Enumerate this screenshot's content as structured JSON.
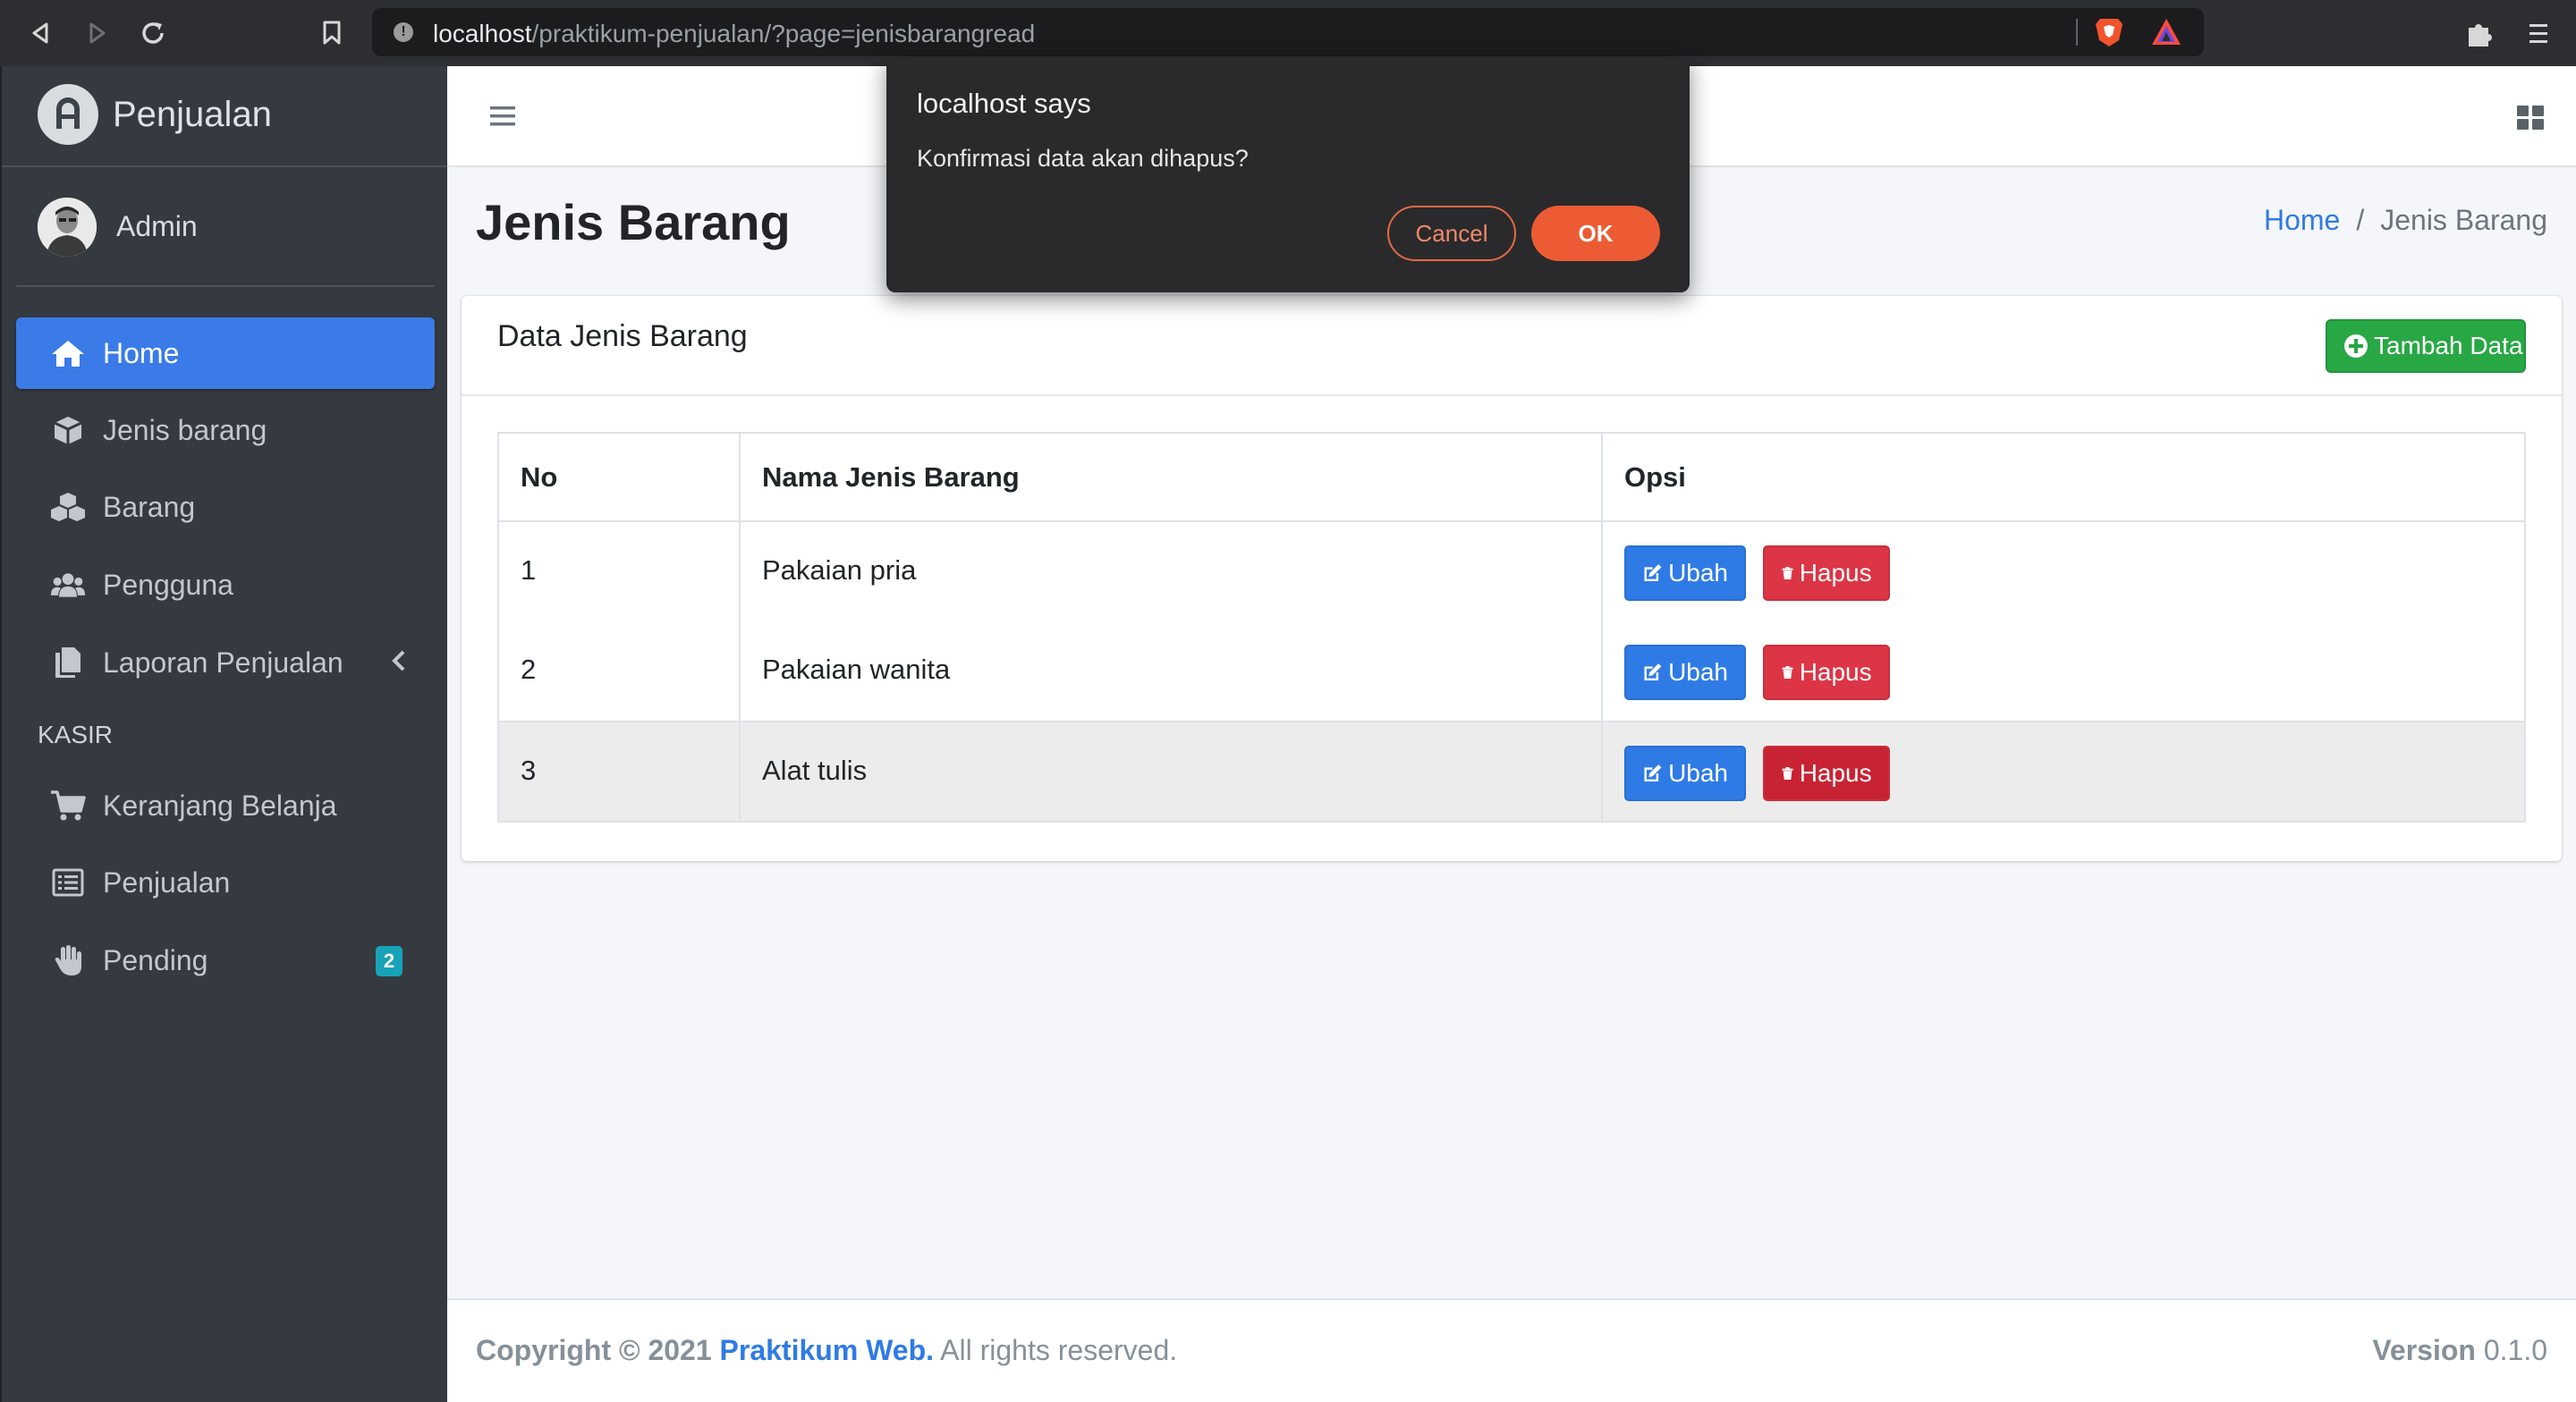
{
  "browser": {
    "url_host": "localhost",
    "url_path": "/praktikum-penjualan/?page=jenisbarangread"
  },
  "sidebar": {
    "brand": "Penjualan",
    "user": "Admin",
    "items": [
      {
        "label": "Home",
        "icon": "home-icon",
        "active": true
      },
      {
        "label": "Jenis barang",
        "icon": "box-icon"
      },
      {
        "label": "Barang",
        "icon": "boxes-icon"
      },
      {
        "label": "Pengguna",
        "icon": "users-icon"
      },
      {
        "label": "Laporan Penjualan",
        "icon": "copy-icon"
      }
    ],
    "section_header": "KASIR",
    "kasir_items": [
      {
        "label": "Keranjang Belanja",
        "icon": "cart-icon"
      },
      {
        "label": "Penjualan",
        "icon": "list-icon"
      },
      {
        "label": "Pending",
        "icon": "hand-icon",
        "badge": "2"
      }
    ]
  },
  "content": {
    "title": "Jenis Barang",
    "breadcrumb": {
      "home": "Home",
      "current": "Jenis Barang"
    },
    "card_title": "Data Jenis Barang",
    "add_button": "Tambah Data",
    "table": {
      "headers": [
        "No",
        "Nama Jenis Barang",
        "Opsi"
      ],
      "rows": [
        {
          "no": "1",
          "name": "Pakaian pria"
        },
        {
          "no": "2",
          "name": "Pakaian wanita"
        },
        {
          "no": "3",
          "name": "Alat tulis"
        }
      ],
      "edit_label": "Ubah",
      "delete_label": "Hapus"
    }
  },
  "footer": {
    "copyright_prefix": "Copyright © 2021",
    "copyright_link": "Praktikum Web.",
    "copyright_suffix": "All rights reserved.",
    "version_label": "Version",
    "version_number": "0.1.0"
  },
  "dialog": {
    "title": "localhost says",
    "message": "Konfirmasi data akan dihapus?",
    "cancel": "Cancel",
    "ok": "OK"
  },
  "colors": {
    "sidebar_bg": "#343a40",
    "primary": "#2f7be5",
    "success": "#28a745",
    "danger": "#dc3545",
    "dialog_accent": "#ec5b34"
  }
}
